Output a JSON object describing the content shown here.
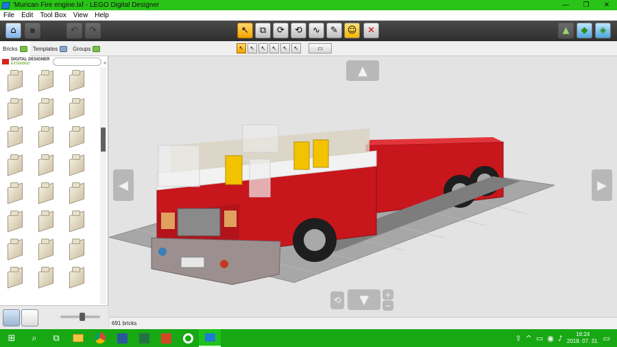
{
  "window": {
    "title": "'Murican Fire engine.lxf - LEGO Digital Designer",
    "minimize": "—",
    "maximize": "❐",
    "close": "✕"
  },
  "menu": [
    "File",
    "Edit",
    "Tool Box",
    "View",
    "Help"
  ],
  "tabs": [
    {
      "label": "Bricks",
      "active": true
    },
    {
      "label": "Templates",
      "active": false
    },
    {
      "label": "Groups",
      "active": false
    }
  ],
  "sidebar": {
    "logo_line1": "DIGITAL DESIGNER",
    "logo_line2": "EXTENDED",
    "search_placeholder": "",
    "collapse": "«"
  },
  "toolbar": {
    "home": "⌂",
    "save": "▪",
    "undo": "↶",
    "redo": "↷",
    "tools": [
      {
        "name": "select-tool",
        "glyph": "↖",
        "active": true
      },
      {
        "name": "clone-tool",
        "glyph": "⧉"
      },
      {
        "name": "hinge-tool",
        "glyph": "⟳"
      },
      {
        "name": "hinge-align-tool",
        "glyph": "⟲"
      },
      {
        "name": "flex-tool",
        "glyph": "∿"
      },
      {
        "name": "paint-tool",
        "glyph": "✎"
      },
      {
        "name": "decoration-tool",
        "glyph": "☺"
      },
      {
        "name": "delete-tool",
        "glyph": "✕"
      }
    ],
    "mode_buttons": [
      "▲",
      "◆",
      "◈"
    ]
  },
  "subtoolbar": {
    "select_modes": [
      "↖",
      "↖",
      "↖",
      "↖",
      "↖",
      "↖"
    ],
    "color_select": "▭"
  },
  "viewport": {
    "arrow_up": "▲",
    "arrow_down": "▼",
    "arrow_left": "◀",
    "arrow_right": "▶",
    "zoom_in": "+",
    "zoom_out": "−",
    "reset": "⟲"
  },
  "status": {
    "brick_count": "691 bricks"
  },
  "taskbar": {
    "start": "⊞",
    "search": "⌕",
    "task_view": "⧉",
    "apps": [
      "explorer",
      "chrome",
      "word",
      "excel",
      "powerpoint",
      "greenshot",
      "lego-digital-designer"
    ],
    "tray": [
      "⇧",
      "^",
      "▭",
      "◉",
      "♪"
    ],
    "time": "16:24",
    "date": "2018. 07. 31.",
    "notify": "▭"
  },
  "colors": {
    "titlebar": "#29c417",
    "taskbar": "#17a814",
    "truck_red": "#c8161d",
    "baseplate": "#9a9a9a"
  }
}
